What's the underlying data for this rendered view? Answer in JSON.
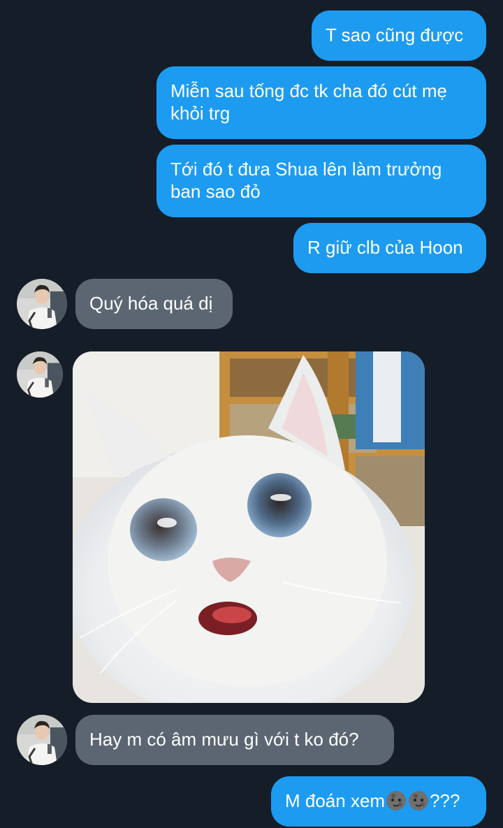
{
  "messages": [
    {
      "id": "m1",
      "direction": "sent",
      "text": "T sao cũng được"
    },
    {
      "id": "m2",
      "direction": "sent",
      "text": "Miễn sau tống đc tk cha đó cút mẹ khỏi trg"
    },
    {
      "id": "m3",
      "direction": "sent",
      "text": "Tới đó t đưa Shua lên làm trưởng ban sao đỏ"
    },
    {
      "id": "m4",
      "direction": "sent",
      "text": "R giữ clb của Hoon"
    },
    {
      "id": "m5",
      "direction": "received",
      "text": "Quý hóa quá dị"
    },
    {
      "id": "m6",
      "direction": "received",
      "type": "image"
    },
    {
      "id": "m7",
      "direction": "received",
      "text": "Hay m có âm mưu gì với t ko đó?"
    },
    {
      "id": "m8",
      "direction": "sent",
      "text_prefix": "M đoán xem",
      "emoji": [
        "new-moon-face",
        "new-moon-face"
      ],
      "text_suffix": "???"
    }
  ],
  "colors": {
    "background": "#151d28",
    "sent_bubble": "#1d9bf0",
    "received_bubble": "#5b6672",
    "text": "#ffffff"
  }
}
